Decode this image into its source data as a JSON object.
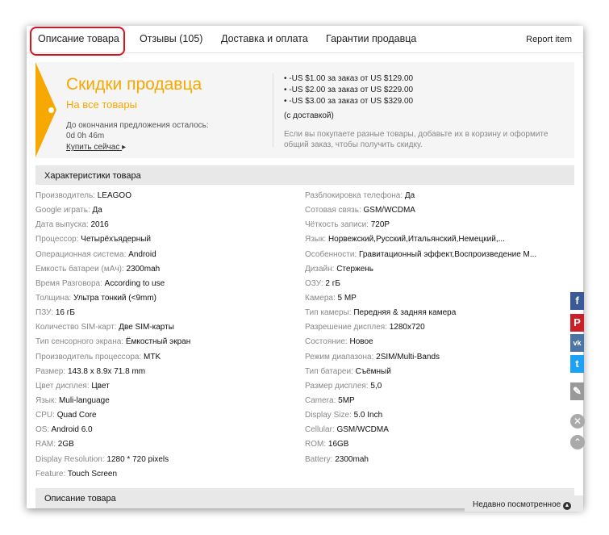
{
  "tabs": [
    {
      "label": "Описание товара",
      "active": true
    },
    {
      "label": "Отзывы (105)"
    },
    {
      "label": "Доставка и оплата"
    },
    {
      "label": "Гарантии продавца"
    }
  ],
  "report_label": "Report item",
  "promo": {
    "title": "Скидки продавца",
    "subtitle": "На все товары",
    "timer": "До окончания предложения осталось: 0d 0h 46m",
    "buy": "Купить сейчас",
    "buy_arrow": "▸",
    "discounts": [
      "-US $1.00 за заказ от US $129.00",
      "-US $2.00 за заказ от US $229.00",
      "-US $3.00 за заказ от US $329.00"
    ],
    "note": "(с доставкой)",
    "info": "Если вы покупаете разные товары, добавьте их в корзину и оформите общий заказ, чтобы получить скидку.",
    "accent": "#f7a800"
  },
  "specs_title": "Характеристики товара",
  "specs_left": [
    {
      "k": "Производитель:",
      "v": "LEAGOO"
    },
    {
      "k": "Google играть:",
      "v": "Да"
    },
    {
      "k": "Дата выпуска:",
      "v": "2016"
    },
    {
      "k": "Процессор:",
      "v": "Четырёхъядерный"
    },
    {
      "k": "Операционная система:",
      "v": "Android"
    },
    {
      "k": "Емкость батареи (мАч):",
      "v": "2300mah"
    },
    {
      "k": "Время Разговора:",
      "v": "According to use"
    },
    {
      "k": "Толщина:",
      "v": "Ультра тонкий (<9mm)"
    },
    {
      "k": "ПЗУ:",
      "v": "16 гБ"
    },
    {
      "k": "Количество SIM-карт:",
      "v": "Две SIM-карты"
    },
    {
      "k": "Тип сенсорного экрана:",
      "v": "Ёмкостный экран"
    },
    {
      "k": "Производитель процессора:",
      "v": "MTK"
    },
    {
      "k": "Размер:",
      "v": "143.8 x 8.9x 71.8 mm"
    },
    {
      "k": "Цвет дисплея:",
      "v": "Цвет"
    },
    {
      "k": "Язык:",
      "v": "Muli-language"
    },
    {
      "k": "CPU:",
      "v": "Quad Core"
    },
    {
      "k": "OS:",
      "v": "Android 6.0"
    },
    {
      "k": "RAM:",
      "v": "2GB"
    },
    {
      "k": "Display Resolution:",
      "v": "1280 * 720 pixels"
    },
    {
      "k": "Feature:",
      "v": "Touch Screen"
    }
  ],
  "specs_right": [
    {
      "k": "Разблокировка телефона:",
      "v": "Да"
    },
    {
      "k": "Сотовая связь:",
      "v": "GSM/WCDMA"
    },
    {
      "k": "Чёткость записи:",
      "v": "720P"
    },
    {
      "k": "Язык:",
      "v": "Норвежский,Русский,Итальянский,Немецкий,..."
    },
    {
      "k": "Особенности:",
      "v": "Гравитационный эффект,Воспроизведение М..."
    },
    {
      "k": "Дизайн:",
      "v": "Стержень"
    },
    {
      "k": "ОЗУ:",
      "v": "2 гБ"
    },
    {
      "k": "Камера:",
      "v": "5 MP"
    },
    {
      "k": "Тип камеры:",
      "v": "Передняя & задняя камера"
    },
    {
      "k": "Разрешение дисплея:",
      "v": "1280x720"
    },
    {
      "k": "Состояние:",
      "v": "Новое"
    },
    {
      "k": "Режим диапазона:",
      "v": "2SIM/Multi-Bands"
    },
    {
      "k": "Тип батареи:",
      "v": "Съёмный"
    },
    {
      "k": "Размер дисплея:",
      "v": "5,0"
    },
    {
      "k": "Camera:",
      "v": "5MP"
    },
    {
      "k": "Display Size:",
      "v": "5.0 Inch"
    },
    {
      "k": "Cellular:",
      "v": "GSM/WCDMA"
    },
    {
      "k": "ROM:",
      "v": "16GB"
    },
    {
      "k": "Battery:",
      "v": "2300mah"
    }
  ],
  "description_title": "Описание товара",
  "recent_label": "Недавно посмотренное",
  "social": [
    {
      "icon": "f",
      "color": "#3b5998",
      "name": "facebook"
    },
    {
      "icon": "P",
      "color": "#cb2027",
      "name": "pinterest"
    },
    {
      "icon": "vk",
      "color": "#4c75a3",
      "name": "vk"
    },
    {
      "icon": "t",
      "color": "#1da1f2",
      "name": "twitter"
    },
    {
      "icon": "✎",
      "color": "#999999",
      "name": "edit"
    }
  ]
}
